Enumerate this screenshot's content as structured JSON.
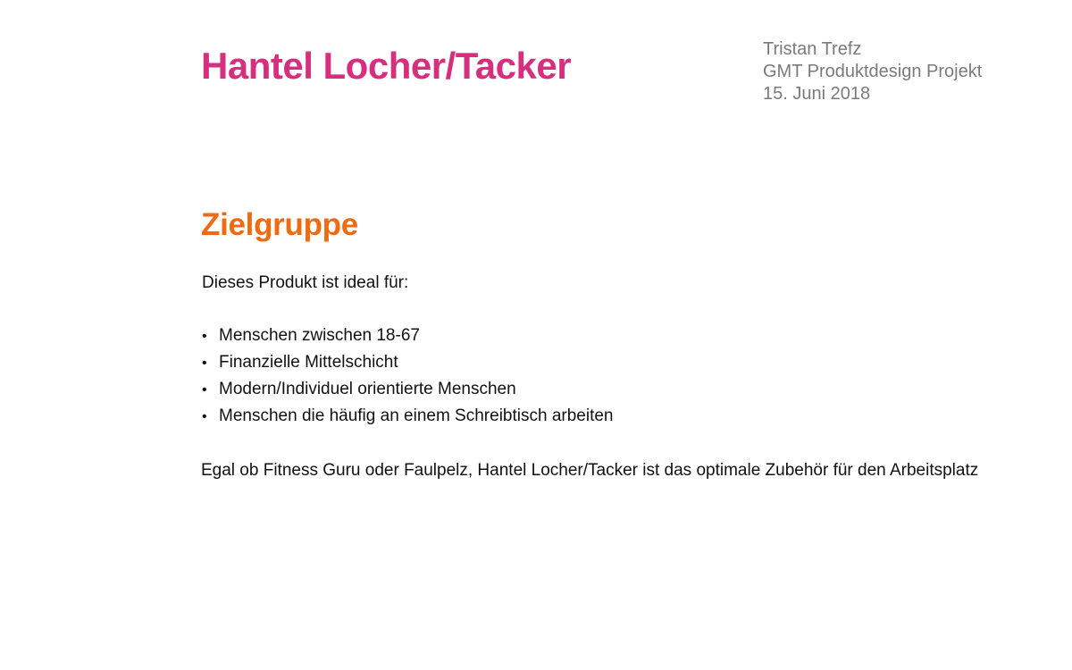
{
  "colors": {
    "title": "#d62f7e",
    "section_heading": "#f06a12",
    "meta_text": "#7a7a7a",
    "body_text": "#111111"
  },
  "header": {
    "title": "Hantel Locher/Tacker",
    "author": "Tristan Trefz",
    "project": "GMT Produktdesign Projekt",
    "date": "15. Juni 2018"
  },
  "section": {
    "heading": "Zielgruppe",
    "intro": "Dieses Produkt ist ideal für:",
    "bullet_symbol": "•",
    "bullets": [
      "Menschen zwischen 18-67",
      "Finanzielle Mittelschicht",
      "Modern/Individuel orientierte Menschen",
      "Menschen die häufig an einem Schreibtisch arbeiten"
    ],
    "closing": "Egal ob Fitness Guru oder Faulpelz, Hantel Locher/Tacker ist das optimale Zubehör für den Arbeitsplatz"
  }
}
